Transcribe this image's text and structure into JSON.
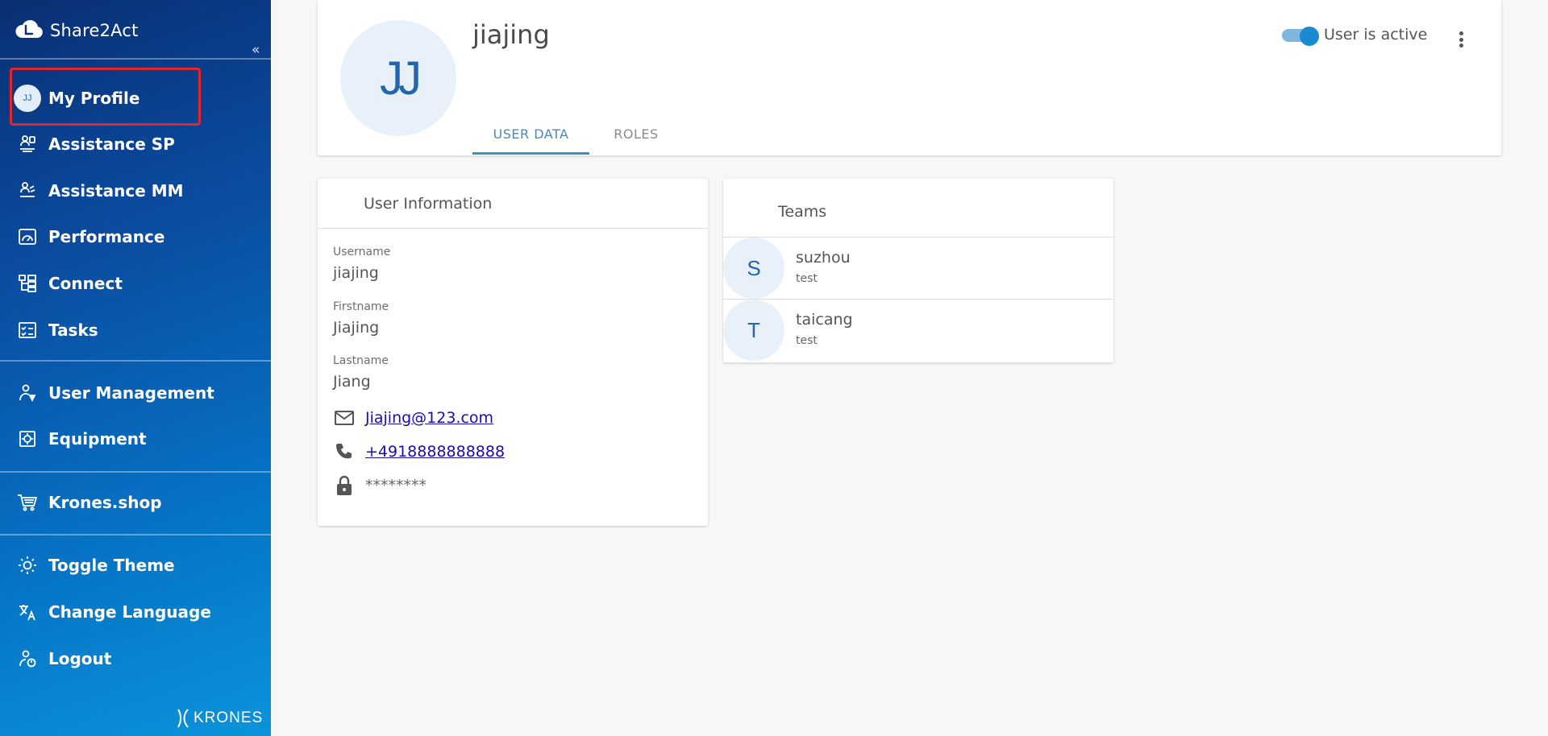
{
  "app": {
    "name": "Share2Act",
    "collapse_glyph": "«",
    "logo_text": "KRONES"
  },
  "sidebar": {
    "items": [
      {
        "label": "My Profile",
        "icon": "avatar",
        "avatar_initials": "JJ"
      },
      {
        "label": "Assistance SP",
        "icon": "assistance-sp-icon"
      },
      {
        "label": "Assistance MM",
        "icon": "assistance-mm-icon"
      },
      {
        "label": "Performance",
        "icon": "gauge-icon"
      },
      {
        "label": "Connect",
        "icon": "network-icon"
      },
      {
        "label": "Tasks",
        "icon": "checklist-icon"
      },
      {
        "label": "User Management",
        "icon": "user-management-icon"
      },
      {
        "label": "Equipment",
        "icon": "equipment-icon"
      },
      {
        "label": "Krones.shop",
        "icon": "cart-icon"
      },
      {
        "label": "Toggle Theme",
        "icon": "brightness-icon"
      },
      {
        "label": "Change Language",
        "icon": "translate-icon"
      },
      {
        "label": "Logout",
        "icon": "logout-icon"
      }
    ]
  },
  "profile": {
    "avatar_initials": "JJ",
    "username": "jiajing",
    "active_label": "User is active",
    "active": true,
    "tabs": [
      {
        "label": "USER DATA",
        "active": true
      },
      {
        "label": "ROLES",
        "active": false
      }
    ]
  },
  "user_info": {
    "title": "User Information",
    "fields": [
      {
        "label": "Username",
        "value": "jiajing"
      },
      {
        "label": "Firstname",
        "value": "Jiajing"
      },
      {
        "label": "Lastname",
        "value": "Jiang"
      }
    ],
    "email": "Jiajing@123.com",
    "phone": "+4918888888888",
    "password": "********"
  },
  "teams": {
    "title": "Teams",
    "items": [
      {
        "initial": "S",
        "name": "suzhou",
        "description": "test"
      },
      {
        "initial": "T",
        "name": "taicang",
        "description": "test"
      }
    ]
  },
  "colors": {
    "sidebar_top": "#0a2f73",
    "sidebar_bottom": "#0a94da",
    "accent": "#3a8fca",
    "highlight": "#e4262c"
  }
}
